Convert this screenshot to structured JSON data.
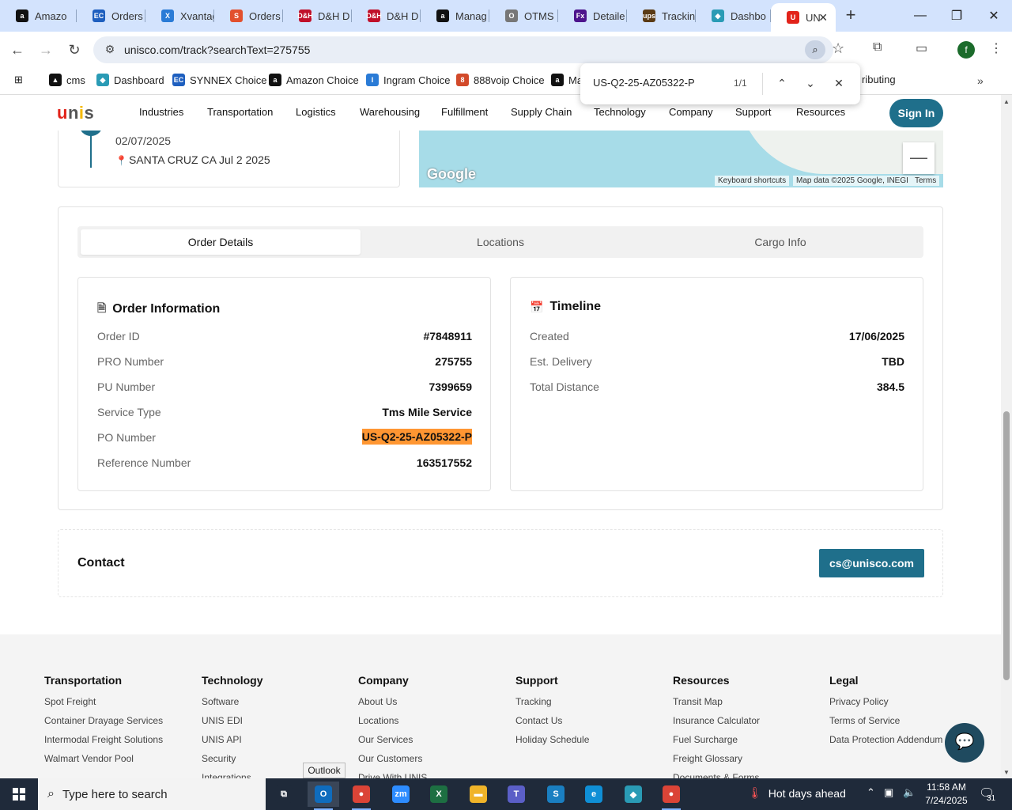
{
  "browser": {
    "tabs": [
      {
        "label": "Amazo",
        "icon": "amazon-icon",
        "color": "#111111",
        "glyph": "a"
      },
      {
        "label": "Orders",
        "icon": "ec-icon",
        "color": "#1e5fbf",
        "glyph": "EC"
      },
      {
        "label": "Xvantag",
        "icon": "xvantage-icon",
        "color": "#2a7bd6",
        "glyph": "X"
      },
      {
        "label": "Orders",
        "icon": "orders-icon",
        "color": "#e2502e",
        "glyph": "S"
      },
      {
        "label": "D&H D",
        "icon": "dh-icon",
        "color": "#c0102a",
        "glyph": "D&H"
      },
      {
        "label": "D&H D",
        "icon": "dh-icon",
        "color": "#c0102a",
        "glyph": "D&H"
      },
      {
        "label": "Manag",
        "icon": "amazon-icon",
        "color": "#111111",
        "glyph": "a"
      },
      {
        "label": "OTMS",
        "icon": "otms-icon",
        "color": "#777777",
        "glyph": "O"
      },
      {
        "label": "Detaile",
        "icon": "fedex-icon",
        "color": "#4d148c",
        "glyph": "Fx"
      },
      {
        "label": "Trackin",
        "icon": "ups-icon",
        "color": "#5a3a14",
        "glyph": "ups"
      },
      {
        "label": "Dashbo",
        "icon": "dashboard-icon",
        "color": "#2a9bb5",
        "glyph": "◆"
      },
      {
        "label": "UN",
        "icon": "unis-icon",
        "color": "#e2231a",
        "glyph": "U"
      }
    ],
    "url": "unisco.com/track?searchText=275755",
    "profile_letter": "f",
    "bookmarks": [
      {
        "label": "cms",
        "icon": "cms-icon",
        "color": "#111111",
        "glyph": "▲"
      },
      {
        "label": "Dashboard",
        "icon": "dashboard-icon",
        "color": "#2a9bb5",
        "glyph": "◆"
      },
      {
        "label": "SYNNEX Choice",
        "icon": "ec-icon",
        "color": "#1e5fbf",
        "glyph": "EC"
      },
      {
        "label": "Amazon Choice",
        "icon": "amazon-icon",
        "color": "#111111",
        "glyph": "a"
      },
      {
        "label": "Ingram Choice",
        "icon": "ingram-icon",
        "color": "#2a7bd6",
        "glyph": "I"
      },
      {
        "label": "888voip Choice",
        "icon": "888voip-icon",
        "color": "#d24a2a",
        "glyph": "8"
      },
      {
        "label": "Ma",
        "icon": "amazon-icon",
        "color": "#111111",
        "glyph": "a"
      },
      {
        "label": "ributing",
        "icon": "",
        "color": "",
        "glyph": ""
      }
    ],
    "find": {
      "query": "US-Q2-25-AZ05322-P",
      "count": "1/1"
    }
  },
  "site": {
    "nav": [
      "Industries",
      "Transportation",
      "Logistics",
      "Warehousing",
      "Fulfillment",
      "Supply Chain",
      "Technology",
      "Company",
      "Support",
      "Resources"
    ],
    "sign_in": "Sign In",
    "logo": {
      "u": "u",
      "n": "n",
      "i": "i",
      "s": "s"
    }
  },
  "tracking": {
    "event_date": "02/07/2025",
    "event_location": "SANTA CRUZ CA Jul 2 2025",
    "map": {
      "brand": "Google",
      "shortcuts": "Keyboard shortcuts",
      "data": "Map data ©2025 Google, INEGI",
      "terms": "Terms",
      "zoom_out": "—"
    }
  },
  "details": {
    "tabs": [
      "Order Details",
      "Locations",
      "Cargo Info"
    ],
    "order_info": {
      "title": "Order Information",
      "rows": [
        {
          "label": "Order ID",
          "value": "#7848911"
        },
        {
          "label": "PRO Number",
          "value": "275755"
        },
        {
          "label": "PU Number",
          "value": "7399659"
        },
        {
          "label": "Service Type",
          "value": "Tms Mile Service"
        },
        {
          "label": "PO Number",
          "value": "US-Q2-25-AZ05322-P"
        },
        {
          "label": "Reference Number",
          "value": "163517552"
        }
      ]
    },
    "timeline": {
      "title": "Timeline",
      "rows": [
        {
          "label": "Created",
          "value": "17/06/2025"
        },
        {
          "label": "Est. Delivery",
          "value": "TBD"
        },
        {
          "label": "Total Distance",
          "value": "384.5"
        }
      ]
    }
  },
  "contact": {
    "title": "Contact",
    "email": "cs@unisco.com"
  },
  "footer": {
    "columns": [
      {
        "title": "Transportation",
        "links": [
          "Spot Freight",
          "Container Drayage Services",
          "Intermodal Freight Solutions",
          "Walmart Vendor Pool"
        ]
      },
      {
        "title": "Technology",
        "links": [
          "Software",
          "UNIS EDI",
          "UNIS API",
          "Security",
          "Integrations"
        ]
      },
      {
        "title": "Company",
        "links": [
          "About Us",
          "Locations",
          "Our Services",
          "Our Customers",
          "Drive With UNIS"
        ]
      },
      {
        "title": "Support",
        "links": [
          "Tracking",
          "Contact Us",
          "Holiday Schedule"
        ]
      },
      {
        "title": "Resources",
        "links": [
          "Transit Map",
          "Insurance Calculator",
          "Fuel Surcharge",
          "Freight Glossary",
          "Documents & Forms"
        ]
      },
      {
        "title": "Legal",
        "links": [
          "Privacy Policy",
          "Terms of Service",
          "Data Protection Addendum"
        ]
      }
    ]
  },
  "taskbar": {
    "search_placeholder": "Type here to search",
    "tooltip": "Outlook",
    "weather": "Hot days ahead",
    "time": "11:58 AM",
    "date": "7/24/2025",
    "notification_count": "31",
    "apps": [
      {
        "icon": "task-view-icon",
        "color": "#1f2a3a",
        "glyph": "⧉"
      },
      {
        "icon": "outlook-icon",
        "color": "#0f6cbd",
        "glyph": "O"
      },
      {
        "icon": "chrome-icon",
        "color": "#db4437",
        "glyph": "●"
      },
      {
        "icon": "zoom-icon",
        "color": "#2d8cff",
        "glyph": "zm"
      },
      {
        "icon": "excel-icon",
        "color": "#1d6f42",
        "glyph": "X"
      },
      {
        "icon": "file-explorer-icon",
        "color": "#f0b429",
        "glyph": "▬"
      },
      {
        "icon": "teams-icon",
        "color": "#5b5fc7",
        "glyph": "T"
      },
      {
        "icon": "sourcetree-icon",
        "color": "#1a7fc1",
        "glyph": "S"
      },
      {
        "icon": "edge-icon",
        "color": "#0f8fd6",
        "glyph": "e"
      },
      {
        "icon": "app-icon",
        "color": "#2a9bb5",
        "glyph": "◆"
      },
      {
        "icon": "chrome-profile-icon",
        "color": "#db4437",
        "glyph": "●"
      }
    ]
  }
}
